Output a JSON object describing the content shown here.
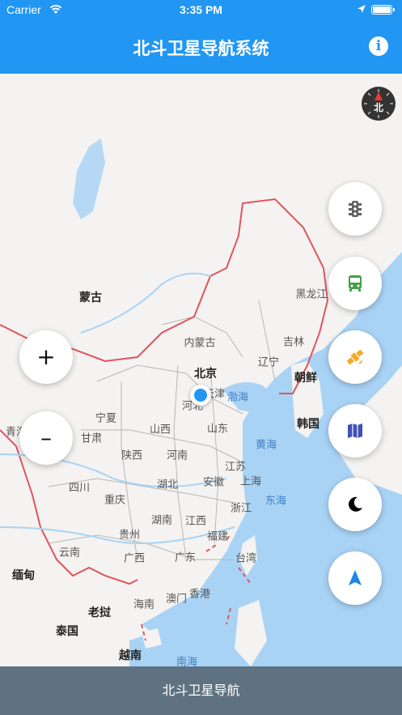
{
  "status_bar": {
    "carrier": "Carrier",
    "time": "3:35 PM"
  },
  "nav": {
    "title": "北斗卫星导航系统",
    "info_label": "i"
  },
  "compass": {
    "label": "北"
  },
  "zoom": {
    "in_label": "+",
    "out_label": "–"
  },
  "fabs": [
    {
      "name": "traffic-button",
      "icon": "traffic-light-icon",
      "color": "#616161"
    },
    {
      "name": "transit-button",
      "icon": "bus-icon",
      "color": "#43a047"
    },
    {
      "name": "satellite-button",
      "icon": "satellite-icon",
      "color": "#f9a825"
    },
    {
      "name": "map-layer-button",
      "icon": "map-icon",
      "color": "#3f51b5"
    },
    {
      "name": "night-mode-button",
      "icon": "moon-icon",
      "color": "#000000"
    },
    {
      "name": "locate-button",
      "icon": "navigation-arrow-icon",
      "color": "#1e88e5"
    }
  ],
  "map": {
    "labels": [
      {
        "id": "mongolia",
        "text": "蒙古",
        "type": "country"
      },
      {
        "id": "neimenggu",
        "text": "内蒙古",
        "type": "region"
      },
      {
        "id": "heilongjiang",
        "text": "黑龙江",
        "type": "region"
      },
      {
        "id": "jilin",
        "text": "吉林",
        "type": "region"
      },
      {
        "id": "liaoning",
        "text": "辽宁",
        "type": "region"
      },
      {
        "id": "beijing",
        "text": "北京",
        "type": "capital"
      },
      {
        "id": "tianjin",
        "text": "天津",
        "type": "region"
      },
      {
        "id": "hebei",
        "text": "河北",
        "type": "region"
      },
      {
        "id": "bohai",
        "text": "渤海",
        "type": "sea"
      },
      {
        "id": "north-korea",
        "text": "朝鲜",
        "type": "country"
      },
      {
        "id": "south-korea",
        "text": "韩国",
        "type": "country"
      },
      {
        "id": "ningxia",
        "text": "宁夏",
        "type": "region"
      },
      {
        "id": "shanxi",
        "text": "山西",
        "type": "region"
      },
      {
        "id": "shandong",
        "text": "山东",
        "type": "region"
      },
      {
        "id": "qinghai",
        "text": "青海",
        "type": "region"
      },
      {
        "id": "gansu",
        "text": "甘肃",
        "type": "region"
      },
      {
        "id": "shaanxi",
        "text": "陕西",
        "type": "region"
      },
      {
        "id": "henan",
        "text": "河南",
        "type": "region"
      },
      {
        "id": "huanghai",
        "text": "黄海",
        "type": "sea"
      },
      {
        "id": "jiangsu",
        "text": "江苏",
        "type": "region"
      },
      {
        "id": "sichuan",
        "text": "四川",
        "type": "region"
      },
      {
        "id": "hubei",
        "text": "湖北",
        "type": "region"
      },
      {
        "id": "anhui",
        "text": "安徽",
        "type": "region"
      },
      {
        "id": "shanghai",
        "text": "上海",
        "type": "region"
      },
      {
        "id": "chongqing",
        "text": "重庆",
        "type": "region"
      },
      {
        "id": "donghai",
        "text": "东海",
        "type": "sea"
      },
      {
        "id": "zhejiang",
        "text": "浙江",
        "type": "region"
      },
      {
        "id": "hunan",
        "text": "湖南",
        "type": "region"
      },
      {
        "id": "jiangxi",
        "text": "江西",
        "type": "region"
      },
      {
        "id": "guizhou",
        "text": "贵州",
        "type": "region"
      },
      {
        "id": "fujian",
        "text": "福建",
        "type": "region"
      },
      {
        "id": "yunnan",
        "text": "云南",
        "type": "region"
      },
      {
        "id": "guangxi",
        "text": "广西",
        "type": "region"
      },
      {
        "id": "guangdong",
        "text": "广东",
        "type": "region"
      },
      {
        "id": "taiwan",
        "text": "台湾",
        "type": "region"
      },
      {
        "id": "myanmar",
        "text": "缅甸",
        "type": "country"
      },
      {
        "id": "hainan",
        "text": "海南",
        "type": "region"
      },
      {
        "id": "macau",
        "text": "澳门",
        "type": "region"
      },
      {
        "id": "hongkong",
        "text": "香港",
        "type": "region"
      },
      {
        "id": "laos",
        "text": "老挝",
        "type": "country"
      },
      {
        "id": "thailand",
        "text": "泰国",
        "type": "country"
      },
      {
        "id": "vietnam",
        "text": "越南",
        "type": "country"
      },
      {
        "id": "nanhai",
        "text": "南海",
        "type": "sea"
      }
    ]
  },
  "bottom_bar": {
    "label": "北斗卫星导航"
  },
  "colors": {
    "primary": "#2196f3",
    "bottom_bar": "#5e7281",
    "sea": "#a9d3f5",
    "border": "#e0555e"
  }
}
